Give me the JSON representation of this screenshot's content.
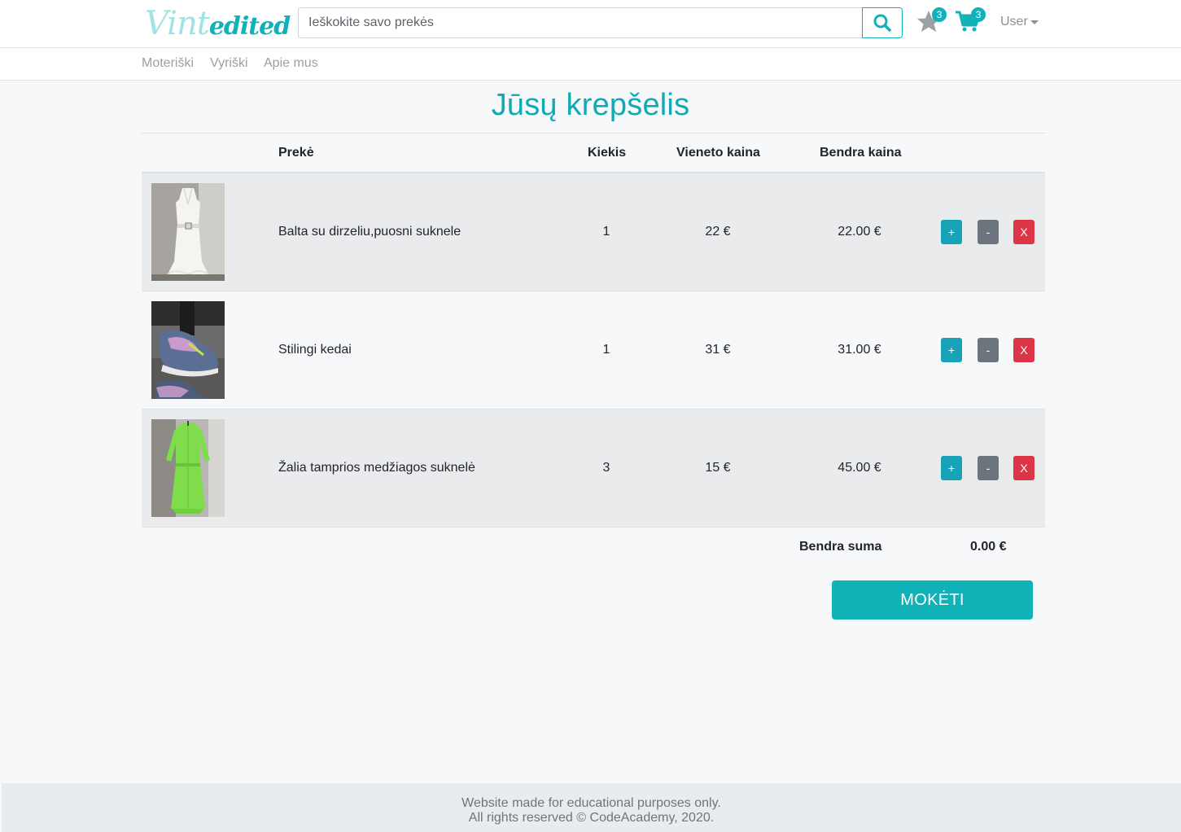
{
  "header": {
    "logo_part1": "Vint",
    "logo_part2": "edited",
    "search_placeholder": "Ieškokite savo prekės",
    "favorites_count": "3",
    "cart_count": "3",
    "user_label": "User"
  },
  "nav": {
    "items": [
      "Moteriški",
      "Vyriški",
      "Apie mus"
    ]
  },
  "page": {
    "title": "Jūsų krepšelis"
  },
  "table": {
    "headers": {
      "item": "Prekė",
      "qty": "Kiekis",
      "unit_price": "Vieneto kaina",
      "total_price": "Bendra kaina"
    },
    "rows": [
      {
        "name": "Balta su dirzeliu,puosni suknele",
        "qty": "1",
        "unit_price": "22 €",
        "total": "22.00 €"
      },
      {
        "name": "Stilingi kedai",
        "qty": "1",
        "unit_price": "31 €",
        "total": "31.00 €"
      },
      {
        "name": "Žalia tamprios medžiagos suknelė",
        "qty": "3",
        "unit_price": "15 €",
        "total": "45.00 €"
      }
    ],
    "actions": {
      "plus": "+",
      "minus": "-",
      "remove": "X"
    }
  },
  "summary": {
    "label": "Bendra suma",
    "value": "0.00 €",
    "pay_button": "MOKĖTI"
  },
  "footer": {
    "line1": "Website made for educational purposes only.",
    "line2": "All rights reserved © CodeAcademy, 2020."
  },
  "colors": {
    "accent": "#11b1b8",
    "danger": "#dc3545",
    "secondary": "#6c757d"
  }
}
